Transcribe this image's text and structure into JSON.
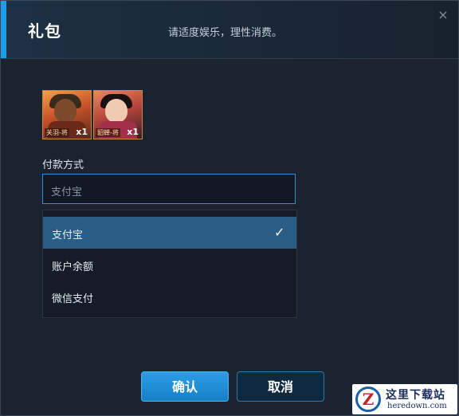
{
  "dialog": {
    "title": "礼包",
    "subtitle": "请适度娱乐，理性消费。",
    "close_icon": "×"
  },
  "items": [
    {
      "name": "关羽-将",
      "qty": "x1"
    },
    {
      "name": "貂蝉-将",
      "qty": "x1"
    }
  ],
  "payment": {
    "label": "付款方式",
    "selected": "支付宝",
    "options": [
      {
        "label": "支付宝",
        "checked": true
      },
      {
        "label": "账户余额",
        "checked": false
      },
      {
        "label": "微信支付",
        "checked": false
      }
    ],
    "check_icon": "✓"
  },
  "buttons": {
    "confirm": "确认",
    "cancel": "取消"
  },
  "watermark": {
    "logo": "Z",
    "text": "这里下载站",
    "url": "heredown.com"
  },
  "colors": {
    "accent": "#1e9ee8",
    "selected_option_bg": "#2a5d86",
    "dialog_bg": "#1b2330"
  }
}
